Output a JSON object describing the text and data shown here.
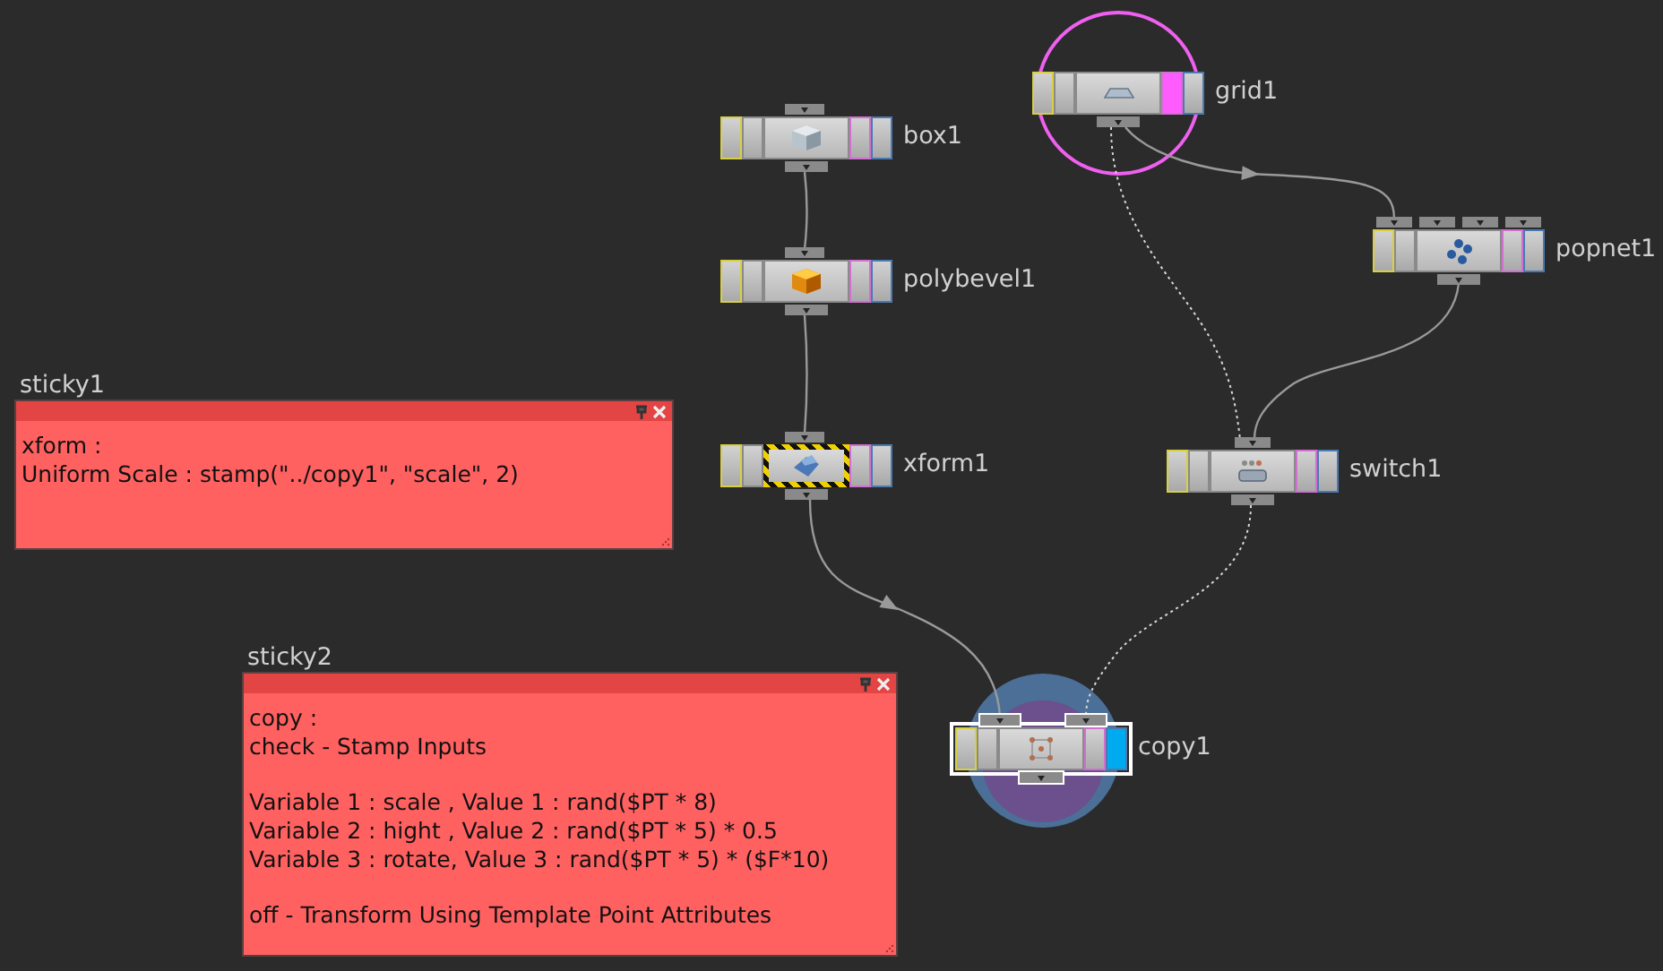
{
  "canvas": {
    "nodes": [
      {
        "name": "box1",
        "kind": "box",
        "display_flag": false,
        "render_flag": false,
        "selected": false,
        "template": false,
        "ring": false
      },
      {
        "name": "polybevel1",
        "kind": "bevel",
        "display_flag": false,
        "render_flag": false,
        "selected": false,
        "template": false,
        "ring": false
      },
      {
        "name": "xform1",
        "kind": "transform",
        "display_flag": false,
        "render_flag": false,
        "selected": false,
        "template": true,
        "ring": false
      },
      {
        "name": "grid1",
        "kind": "grid",
        "display_flag": true,
        "render_flag": false,
        "selected": false,
        "template": false,
        "ring": true
      },
      {
        "name": "popnet1",
        "kind": "particles",
        "display_flag": false,
        "render_flag": false,
        "selected": false,
        "template": false,
        "ring": false
      },
      {
        "name": "switch1",
        "kind": "switch",
        "display_flag": false,
        "render_flag": false,
        "selected": false,
        "template": false,
        "ring": false
      },
      {
        "name": "copy1",
        "kind": "copy",
        "display_flag": false,
        "render_flag": true,
        "selected": true,
        "template": false,
        "ring": true
      }
    ],
    "connections": [
      {
        "dotted": false,
        "arrow": false
      },
      {
        "dotted": false,
        "arrow": false
      },
      {
        "dotted": false,
        "arrow": true
      },
      {
        "dotted": true,
        "arrow": false
      },
      {
        "dotted": false,
        "arrow": true
      },
      {
        "dotted": false,
        "arrow": false
      },
      {
        "dotted": true,
        "arrow": false
      }
    ],
    "sticky_notes": [
      {
        "title": "sticky1",
        "paragraphs": [
          [
            "xform :",
            "Uniform Scale : stamp(\"../copy1\", \"scale\", 2)"
          ]
        ]
      },
      {
        "title": "sticky2",
        "paragraphs": [
          [
            "copy :",
            "check - Stamp Inputs"
          ],
          [
            "Variable 1 : scale , Value 1 : rand($PT * 8)",
            "Variable 2 : hight , Value 2 : rand($PT * 5) * 0.5",
            "Variable 3 : rotate, Value 3 : rand($PT * 5) * ($F*10)"
          ],
          [
            "off - Transform Using Template Point Attributes"
          ]
        ]
      }
    ]
  }
}
